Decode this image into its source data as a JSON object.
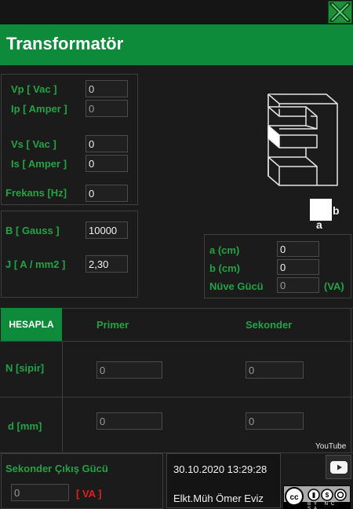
{
  "window": {
    "title": "Transformatör",
    "close_icon": "close-x-icon",
    "top_small_text": ""
  },
  "inputs_panel": {
    "vp_label": "Vp [ Vac ]",
    "vp_value": "0",
    "ip_label": "Ip [ Amper ]",
    "ip_value": "0",
    "vs_label": "Vs [ Vac ]",
    "vs_value": "0",
    "is_label": "Is [ Amper ]",
    "is_value": "0",
    "freq_label": "Frekans [Hz]",
    "freq_value": "0"
  },
  "core_panel": {
    "b_label": "B [ Gauss ]",
    "b_value": "10000",
    "j_label": "J [ A / mm2 ]",
    "j_value": "2,30"
  },
  "diagram": {
    "icon": "transformer-core-icon",
    "label_b": "b",
    "label_a": "a"
  },
  "core_size_panel": {
    "a_label": "a (cm)",
    "a_value": "0",
    "b_label": "b (cm)",
    "b_value": "0",
    "power_label": "Nüve Gücü",
    "power_value": "0",
    "power_unit": "(VA)"
  },
  "calc": {
    "button_label": "HESAPLA",
    "col_primary": "Primer",
    "col_secondary": "Sekonder",
    "row_n_label": "N [sipir]",
    "row_d_label": "d [mm]",
    "n_primary": "0",
    "n_secondary": "0",
    "d_primary": "0",
    "d_secondary": "0"
  },
  "output": {
    "label": "Sekonder Çıkış Gücü",
    "value": "0",
    "unit": "[ VA ]"
  },
  "footer": {
    "datetime": "30.10.2020 13:29:28",
    "author": "Elkt.Müh Ömer Eviz",
    "youtube_label": "YouTube",
    "youtube_icon": "youtube-play-icon",
    "license_icon": "cc-by-nc-sa-icon",
    "license_text": "BY NC SA"
  },
  "colors": {
    "accent": "#0d8a3a",
    "label_green": "#22a344",
    "background": "#1b1b1b",
    "unit_red": "#e02020"
  }
}
